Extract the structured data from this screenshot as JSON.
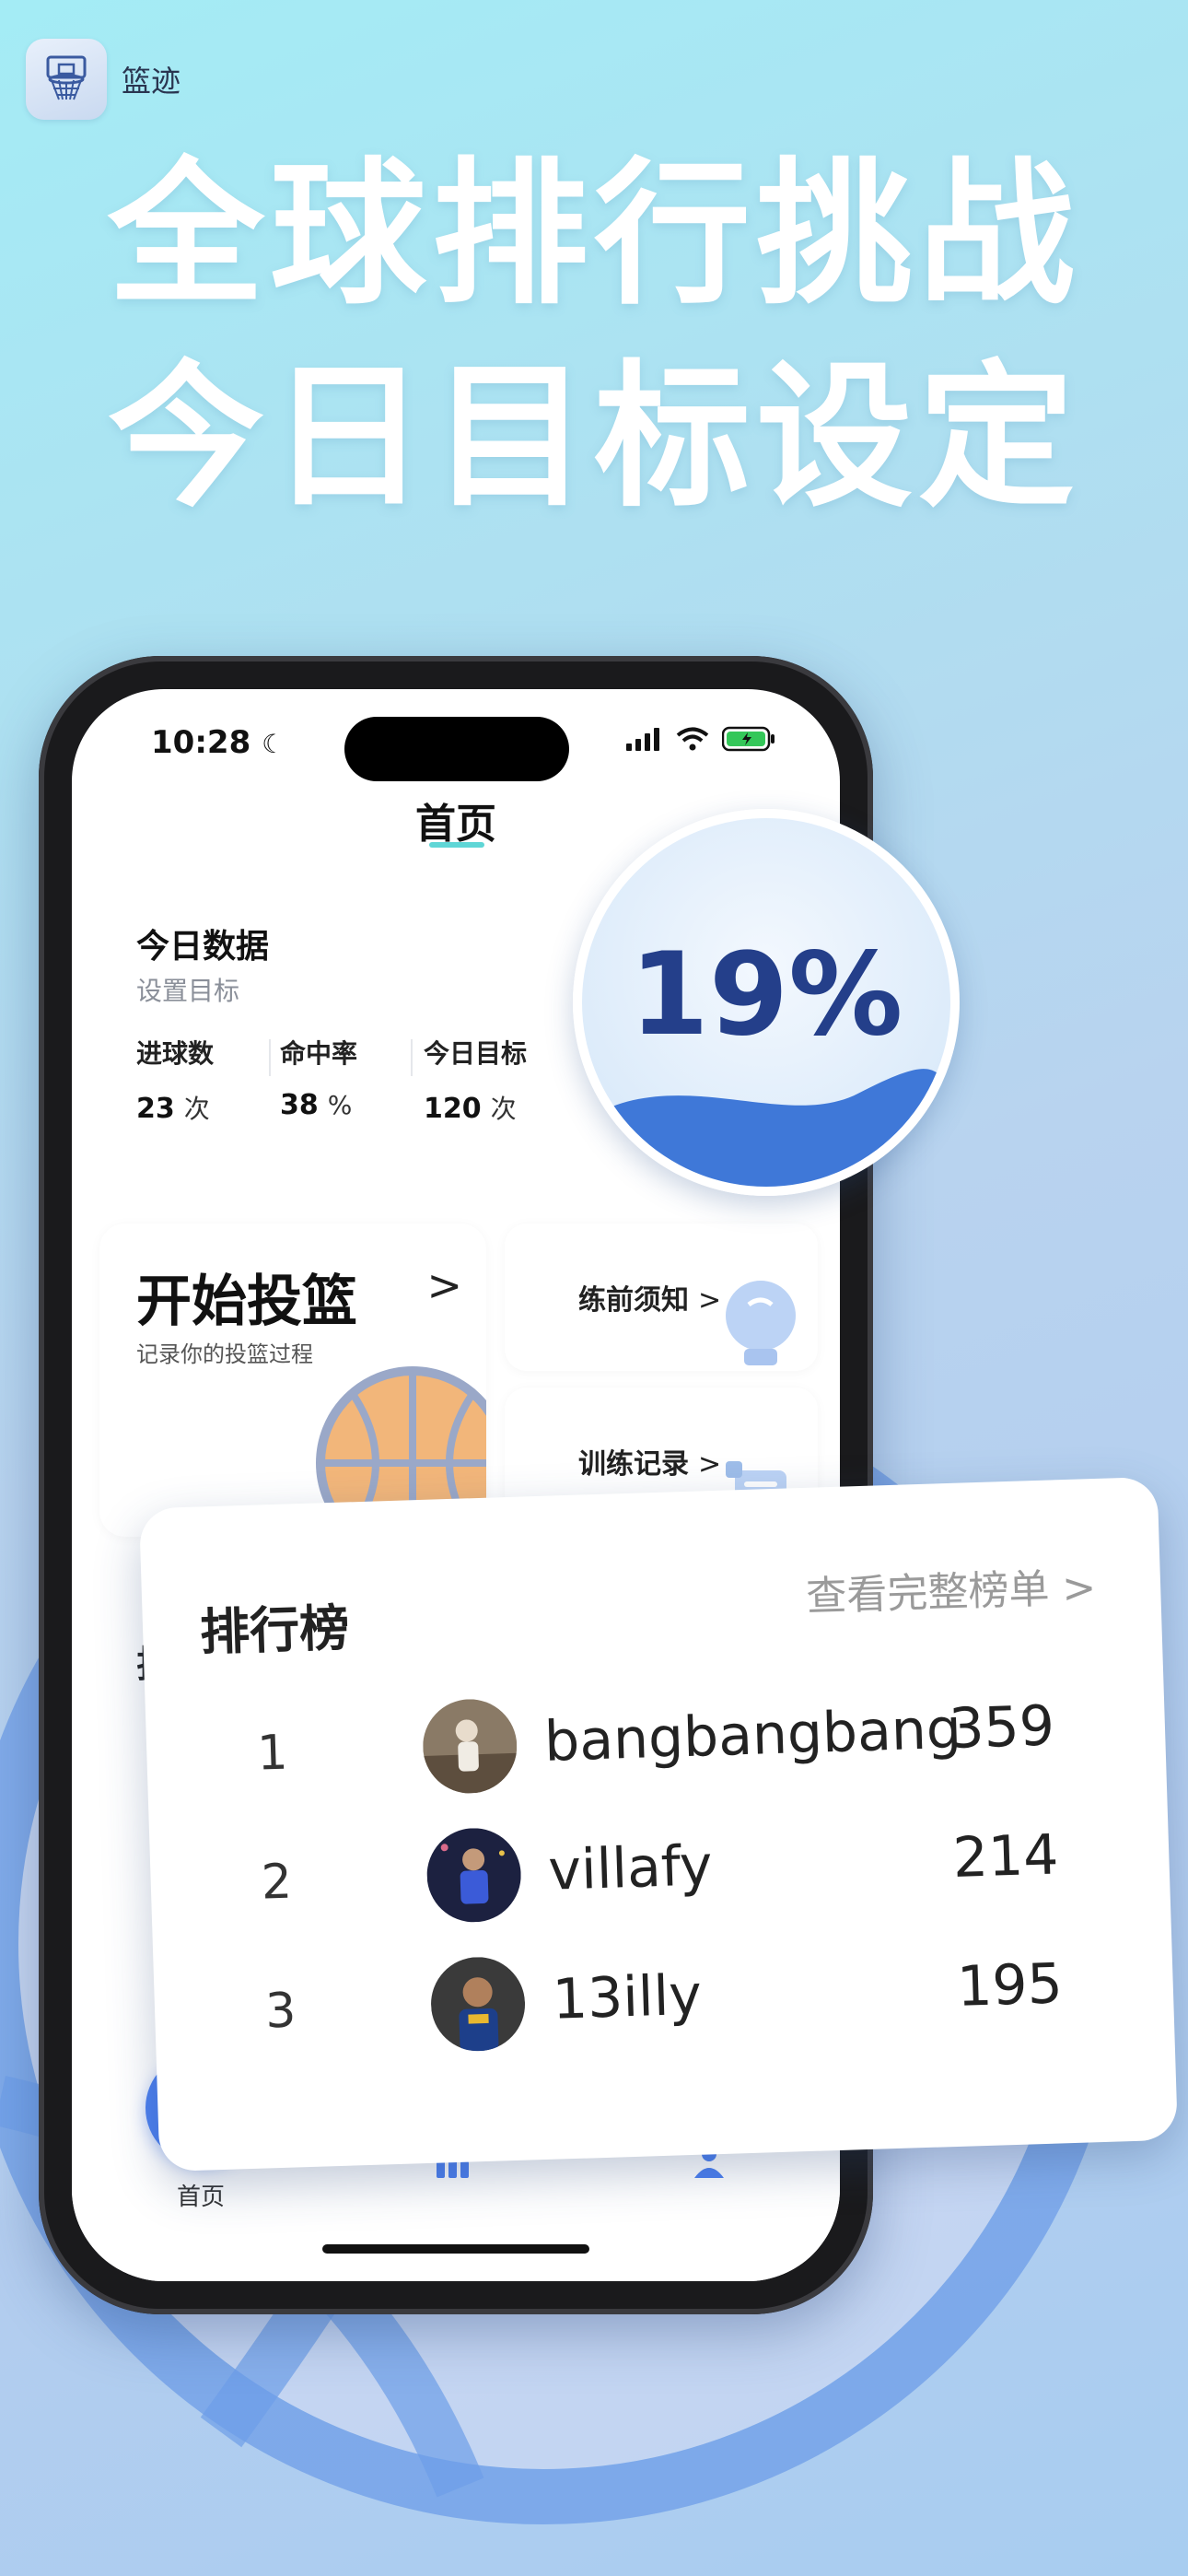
{
  "app": {
    "name": "篮迹",
    "icon": "basketball-hoop-icon"
  },
  "headline": {
    "line1": "全球排行挑战",
    "line2": "今日目标设定"
  },
  "status_bar": {
    "time": "10:28"
  },
  "screen": {
    "title": "首页",
    "today": {
      "title": "今日数据",
      "subtitle": "设置目标",
      "stats": [
        {
          "label": "进球数",
          "value": "23",
          "unit": "次"
        },
        {
          "label": "命中率",
          "value": "38",
          "unit": "%"
        },
        {
          "label": "今日目标",
          "value": "120",
          "unit": "次"
        }
      ]
    },
    "start_card": {
      "title": "开始投篮",
      "chevron": ">",
      "subtitle": "记录你的投篮过程"
    },
    "small_cards": [
      {
        "label": "练前须知",
        "chevron": ">"
      },
      {
        "label": "训练记录",
        "chevron": ">"
      }
    ],
    "hidden_card": {
      "title": "排"
    },
    "tab_bar": {
      "home_label": "首页"
    }
  },
  "progress": {
    "text": "19%",
    "fraction": 0.19
  },
  "leaderboard": {
    "title": "排行榜",
    "more": "查看完整榜单 >",
    "rows": [
      {
        "rank": "1",
        "name": "bangbangbang",
        "score": "359"
      },
      {
        "rank": "2",
        "name": "villafy",
        "score": "214"
      },
      {
        "rank": "3",
        "name": "13illy",
        "score": "195"
      }
    ]
  },
  "colors": {
    "accent": "#4d80f0",
    "progress_text": "#243f8a",
    "wave": "#3f78d8"
  }
}
